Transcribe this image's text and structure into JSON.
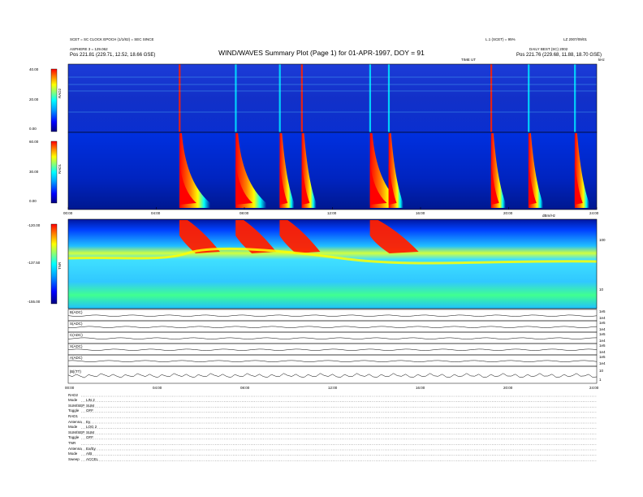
{
  "header": {
    "title": "WIND/WAVES Summary Plot (Page 1) for 01-APR-1997, DOY = 91",
    "left_line1": "SCET = SC CLOCK EPOCH (1/1/82) = SEC SINCE",
    "left_line2": "ASPHERE 3 = 129.062",
    "left_line3": "Pos    221.81 (229.71, 12.52, 18.66 GSE)",
    "right_line1": "L.1 (SCET) = 95%",
    "right_line1b": "LZ 2007/09/01",
    "right_line2": "DAILY BEST (SC) 2002",
    "right_line3": "Pos    221.76 (229.68, 11.88, 18.70 GSE)",
    "top_time_label": "TIME UT",
    "top_right_label": "kHz"
  },
  "chart_data": [
    {
      "type": "heatmap",
      "panel": "RAD2",
      "ylabel": "RAD2",
      "color_ticks": [
        "40.00",
        "20.00",
        "0.00"
      ],
      "clim": [
        0,
        40
      ],
      "colormap": [
        "#000080",
        "#0000ff",
        "#00a0ff",
        "#00ffff",
        "#80ff80",
        "#ffff00",
        "#ff8000",
        "#ff0000"
      ],
      "x_range_hours": [
        0,
        24
      ],
      "bursts_hours": [
        5.05,
        7.6,
        9.6,
        10.6,
        13.7,
        14.55,
        19.2,
        20.9,
        23.0
      ]
    },
    {
      "type": "heatmap",
      "panel": "RAD1",
      "ylabel": "RAD1",
      "color_ticks": [
        "60.00",
        "30.00",
        "0.00"
      ],
      "clim": [
        0,
        60
      ],
      "x_tick_labels": [
        "00:00",
        "04:00",
        "08:00",
        "12:00",
        "16:00",
        "20:00",
        "24:00"
      ],
      "x_range_hours": [
        0,
        24
      ],
      "bursts_hours": [
        5.05,
        7.6,
        9.6,
        10.6,
        13.7,
        14.55,
        19.2,
        20.9,
        23.0
      ]
    },
    {
      "type": "heatmap",
      "panel": "TNR",
      "ylabel": "TNR",
      "color_ticks": [
        "-120.00",
        "-137.50",
        "-155.00"
      ],
      "clim": [
        -155,
        -120
      ],
      "right_axis_ticks": [
        "100",
        "10"
      ],
      "right_axis_label": "dBm/Hz",
      "x_range_hours": [
        0,
        24
      ]
    },
    {
      "type": "line",
      "panel": "housekeeping",
      "series_labels": [
        "B(ADC)",
        "S(ADC)",
        "C(ADC)",
        "X(ADC)",
        "A(ADC)",
        "|B|(TT)"
      ],
      "right_ticks": [
        [
          "1e5",
          "1e4"
        ],
        [
          "1e5",
          "1e4"
        ],
        [
          "1e5",
          "1e4"
        ],
        [
          "1e5",
          "1e4"
        ],
        [
          "1e5",
          "1e4"
        ],
        [
          "10",
          "1"
        ]
      ],
      "x_tick_labels": [
        "00:00",
        "04:00",
        "08:00",
        "12:00",
        "16:00",
        "20:00",
        "24:00"
      ],
      "x_range_hours": [
        0,
        24
      ]
    }
  ],
  "legend_table": [
    {
      "label": "RAD2",
      "value": ""
    },
    {
      "label": "Mode",
      "value": "LIN 2"
    },
    {
      "label": "SUM/SEP",
      "value": "SUM"
    },
    {
      "label": "Toggle",
      "value": "OFF"
    },
    {
      "label": "RAD1",
      "value": ""
    },
    {
      "label": "Antenna",
      "value": "Ey"
    },
    {
      "label": "Mode",
      "value": "LOG 2"
    },
    {
      "label": "SUM/SEP",
      "value": "SUM"
    },
    {
      "label": "Toggle",
      "value": "OFF"
    },
    {
      "label": "TNR",
      "value": ""
    },
    {
      "label": "Antenna",
      "value": "Ex/Ey"
    },
    {
      "label": "Mode",
      "value": "A/B"
    },
    {
      "label": "Sweep",
      "value": "ACCEL"
    }
  ]
}
